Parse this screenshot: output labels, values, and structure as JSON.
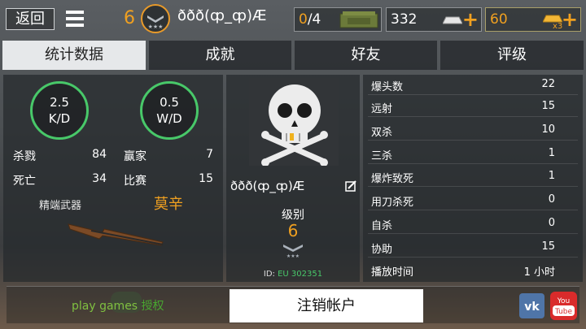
{
  "topbar": {
    "back_label": "返回",
    "player_level": "6",
    "player_name": "ððð(ȹ_ȹ)Æ",
    "crates": {
      "current": "0",
      "total": "/4",
      "icon": "ammo-crate-icon"
    },
    "silver": {
      "value": "332",
      "icon": "silver-bar-icon",
      "plus": "+"
    },
    "gold": {
      "value": "60",
      "icon": "gold-bar-icon",
      "multiplier": "x3",
      "plus": "+"
    }
  },
  "tabs": [
    "统计数据",
    "成就",
    "好友",
    "评级"
  ],
  "left": {
    "kd": {
      "value": "2.5",
      "label": "K/D"
    },
    "wd": {
      "value": "0.5",
      "label": "W/D"
    },
    "stats": [
      {
        "label": "杀戮",
        "value": "84"
      },
      {
        "label": "死亡",
        "value": "34"
      },
      {
        "label": "赢家",
        "value": "7"
      },
      {
        "label": "比赛",
        "value": "15"
      }
    ],
    "weapon_label": "精端武器",
    "weapon_name": "莫辛"
  },
  "middle": {
    "name": "ððð(ȹ_ȹ)Æ",
    "level_label": "级别",
    "level_value": "6",
    "id_prefix": "ID: ",
    "id_value": "EU 302351"
  },
  "right": {
    "rows": [
      {
        "label": "爆头数",
        "value": "22"
      },
      {
        "label": "远射",
        "value": "15"
      },
      {
        "label": "双杀",
        "value": "10"
      },
      {
        "label": "三杀",
        "value": "1"
      },
      {
        "label": "爆炸致死",
        "value": "1"
      },
      {
        "label": "用刀杀死",
        "value": "0"
      },
      {
        "label": "自杀",
        "value": "0"
      },
      {
        "label": "协助",
        "value": "15"
      },
      {
        "label": "播放时间",
        "value": "1 小时"
      }
    ]
  },
  "bottom": {
    "play_games": "play games",
    "authorize": "授权",
    "logout": "注销帐户"
  },
  "colors": {
    "accent": "#f0a020",
    "green": "#48c869",
    "tab_active": "#e6e8ea"
  }
}
